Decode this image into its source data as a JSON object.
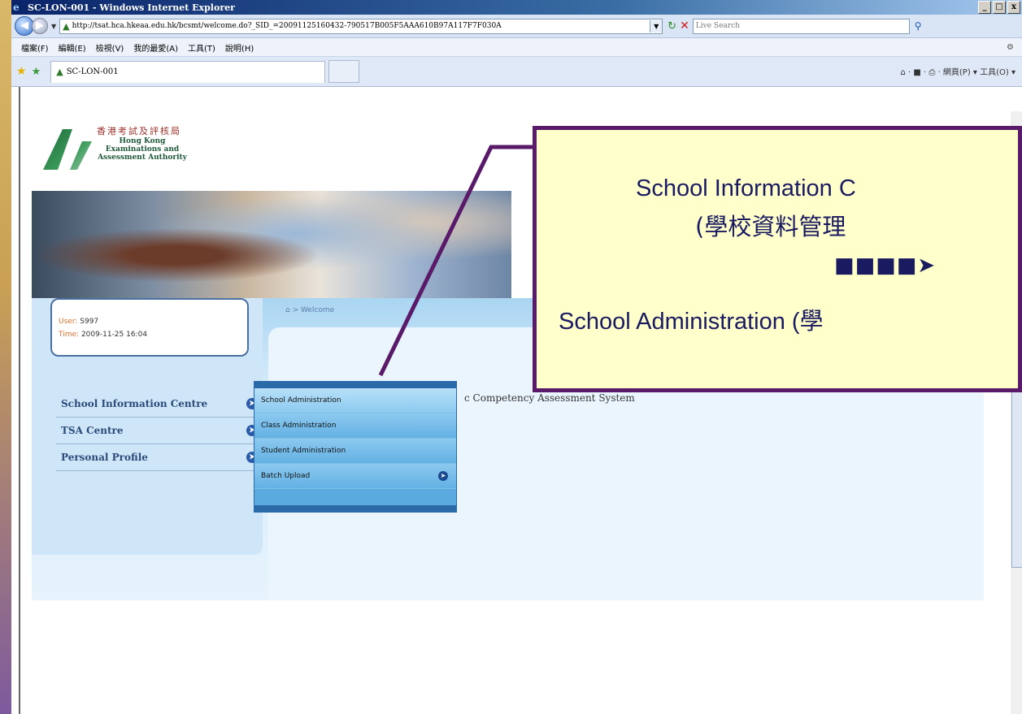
{
  "window": {
    "title": "SC-LON-001 - Windows Internet Explorer",
    "controls": [
      "_",
      "□",
      "x"
    ]
  },
  "address": {
    "url": "http://tsat.hca.hkeaa.edu.hk/bcsmt/welcome.do?_SID_=20091125160432-790517B005F5AAA610B97A117F7F030A",
    "search_placeholder": "Live Search"
  },
  "menubar": {
    "items": [
      "檔案(F)",
      "編輯(E)",
      "檢視(V)",
      "我的最愛(A)",
      "工具(T)",
      "說明(H)"
    ]
  },
  "tabbar": {
    "tab_title": "SC-LON-001",
    "tools": "網頁(P) ▾   工具(O) ▾"
  },
  "logo": {
    "cn": "香港考試及評核局",
    "en_line1": "Hong Kong",
    "en_line2": "Examinations and",
    "en_line3": "Assessment Authority"
  },
  "user": {
    "user_label": "User:",
    "user_value": "S997",
    "time_label": "Time:",
    "time_value": "2009-11-25 16:04"
  },
  "breadcrumb": "> Welcome",
  "subtitle": "c Competency Assessment System",
  "nav": {
    "items": [
      "School Information Centre",
      "TSA Centre",
      "Personal Profile"
    ]
  },
  "submenu": {
    "items": [
      "School Administration",
      "Class Administration",
      "Student Administration",
      "Batch Upload"
    ]
  },
  "callout": {
    "line1": "School Information C",
    "line2": "(學校資料管理",
    "line3": "School Administration (學"
  },
  "colors": {
    "callout_bg": "#ffffcc",
    "callout_border": "#5a1a6a",
    "nav_text": "#2a4a7a",
    "submenu_bg": "#5aaae0"
  }
}
